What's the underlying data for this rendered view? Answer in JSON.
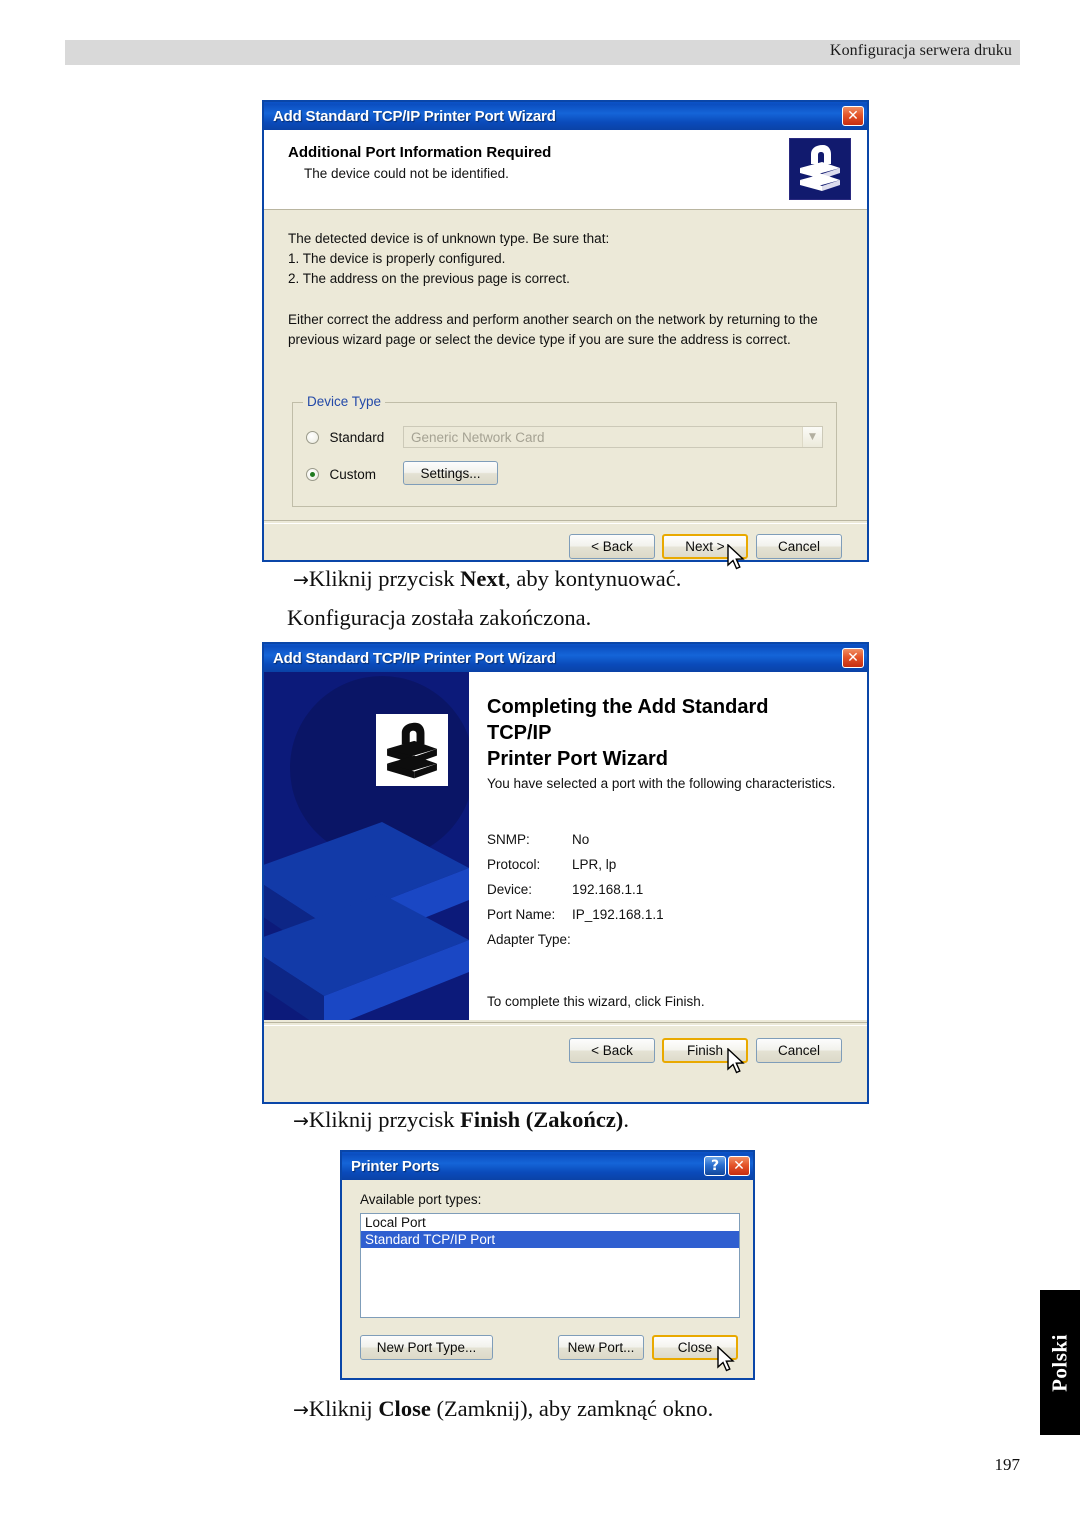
{
  "page": {
    "header_text": "Konfiguracja serwera druku",
    "side_tab_label": "Polski",
    "page_number": "197"
  },
  "captions": {
    "after_dialog1_line1_arrow": "→",
    "after_dialog1_line1_a": "Kliknij przycisk ",
    "after_dialog1_line1_b": "Next",
    "after_dialog1_line1_c": ", aby kontynuować.",
    "after_dialog1_line2": "Konfiguracja została zakończona.",
    "after_dialog2_arrow": "→",
    "after_dialog2_a": "Kliknij przycisk ",
    "after_dialog2_b": "Finish (Zakończ)",
    "after_dialog2_c": ".",
    "after_dialog3_arrow": "→",
    "after_dialog3_a": "Kliknij ",
    "after_dialog3_b": "Close",
    "after_dialog3_c": " (Zamknij), aby zamknąć okno."
  },
  "dialog1": {
    "title": "Add Standard TCP/IP Printer Port Wizard",
    "close_label": "✕",
    "heading": "Additional Port Information Required",
    "subheading": "The device could not be identified.",
    "paragraph1_line1": "The detected device is of unknown type.  Be sure that:",
    "paragraph1_line2": "1. The device is properly configured.",
    "paragraph1_line3": "2.  The address on the previous page is correct.",
    "paragraph2_line1": "Either correct the address and perform another search on the network by returning to the",
    "paragraph2_line2": "previous wizard page or select the device type if you are sure the address is correct.",
    "groupbox_title": "Device Type",
    "radio_standard_label": "Standard",
    "radio_standard_checked": false,
    "combo_value": "Generic Network Card",
    "radio_custom_label": "Custom",
    "radio_custom_checked": true,
    "settings_button": "Settings...",
    "back_button": "< Back",
    "next_button": "Next >",
    "cancel_button": "Cancel"
  },
  "dialog2": {
    "title": "Add Standard TCP/IP Printer Port Wizard",
    "close_label": "✕",
    "heading_line1": "Completing the Add Standard TCP/IP",
    "heading_line2": "Printer Port Wizard",
    "subheading": "You have selected a port with the following characteristics.",
    "properties": [
      {
        "key": "SNMP:",
        "value": "No"
      },
      {
        "key": "Protocol:",
        "value": "LPR, lp"
      },
      {
        "key": "Device:",
        "value": "192.168.1.1"
      },
      {
        "key": "Port Name:",
        "value": "IP_192.168.1.1"
      },
      {
        "key": "Adapter Type:",
        "value": ""
      }
    ],
    "footer_note": "To complete this wizard, click Finish.",
    "back_button": "< Back",
    "finish_button": "Finish",
    "cancel_button": "Cancel"
  },
  "dialog3": {
    "title": "Printer Ports",
    "help_label": "?",
    "close_label": "✕",
    "list_label": "Available port types:",
    "ports": [
      {
        "name": "Local Port",
        "selected": false
      },
      {
        "name": "Standard TCP/IP Port",
        "selected": true
      }
    ],
    "new_port_type_button": "New Port Type...",
    "new_port_button": "New Port...",
    "close_button": "Close"
  },
  "colors": {
    "titlebar_blue": "#0b4ec0",
    "dialog_face": "#ece9d8",
    "default_button_outline": "#e9a900",
    "selection_blue": "#2f5fd0",
    "header_gray": "#d9d9d9",
    "wizard_panel_navy": "#0c1a7a"
  }
}
